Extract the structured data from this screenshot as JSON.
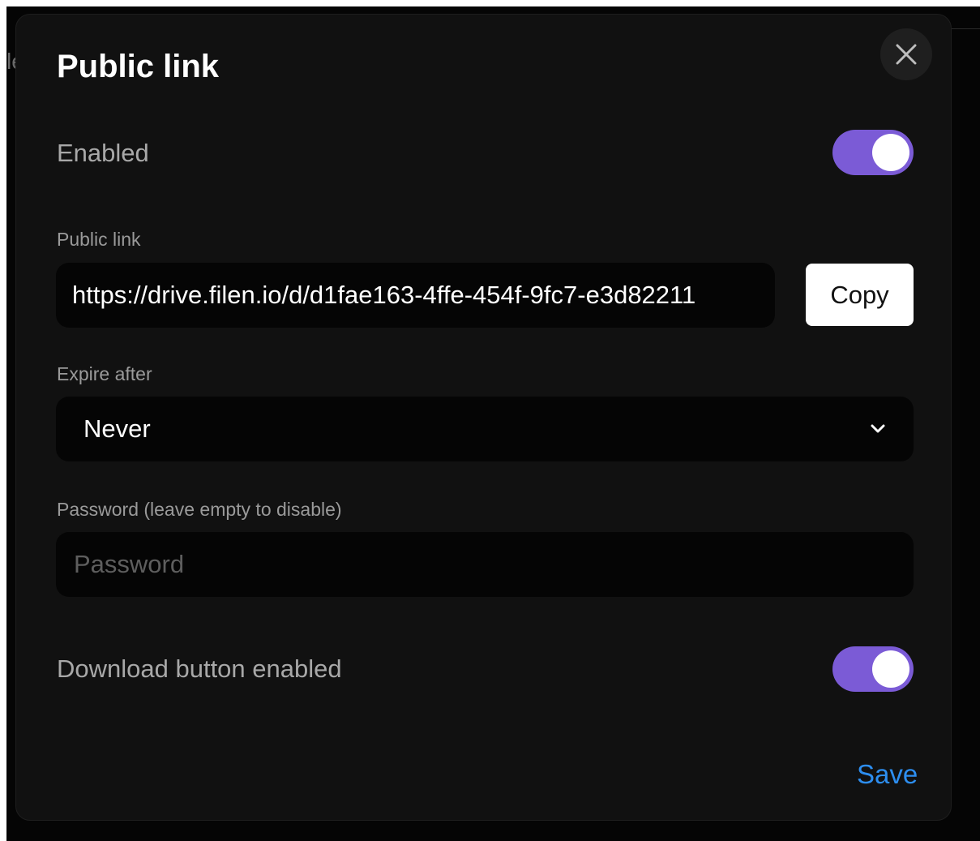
{
  "background": {
    "partial_text": "le"
  },
  "modal": {
    "title": "Public link",
    "close_icon": "close-icon",
    "enabled_label": "Enabled",
    "enabled_on": true,
    "public_link_label": "Public link",
    "public_link_value": "https://drive.filen.io/d/d1fae163-4ffe-454f-9fc7-e3d82211",
    "copy_label": "Copy",
    "expire_label": "Expire after",
    "expire_value": "Never",
    "expire_icon": "chevron-down-icon",
    "password_label": "Password (leave empty to disable)",
    "password_placeholder": "Password",
    "password_value": "",
    "download_label": "Download button enabled",
    "download_on": true,
    "save_label": "Save"
  },
  "colors": {
    "accent_toggle": "#7b5bd6",
    "save_link": "#2d8ef0",
    "modal_bg": "#111111",
    "field_bg": "#050505"
  }
}
